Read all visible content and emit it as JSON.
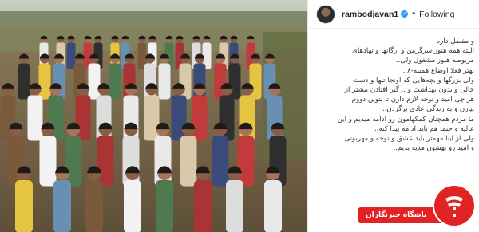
{
  "post": {
    "username": "rambodjavan1",
    "verified_icon": "verified-badge-icon",
    "separator": "•",
    "follow_label": "Following"
  },
  "caption_lines": [
    "و مفصل داره",
    "البته همه هنوز سرگرمن و ارگانها و نهادهای",
    "مربوطه هنوز مشغول ولی..",
    "بهتر فعلا اوضاع همینه-۸..",
    "ولی بزرگها و بچه‌هایی که اونجا تنها و دست",
    "خالی و بدون بهداشت و .. گیر افتادن بیشتر از",
    "هر چی امید و توجه لازم دارن تا بتونن دووم",
    "بیارن و به زندگی عادی برگردن..",
    "ما مردم همچنان کمکهامون رو ادامه میدیم و این",
    "عالیه و حتما هم باید ادامه پیدا کنه..",
    "ولی از اینا مهمتر باید عشق و توجه و مهربونی",
    "و امید رو بهشون هدیه بدیم.."
  ],
  "watermark": {
    "text": "باشگاه خبرنگاران",
    "color": "#e32323"
  },
  "colors": {
    "verified": "#3897f0",
    "text": "#262626"
  }
}
